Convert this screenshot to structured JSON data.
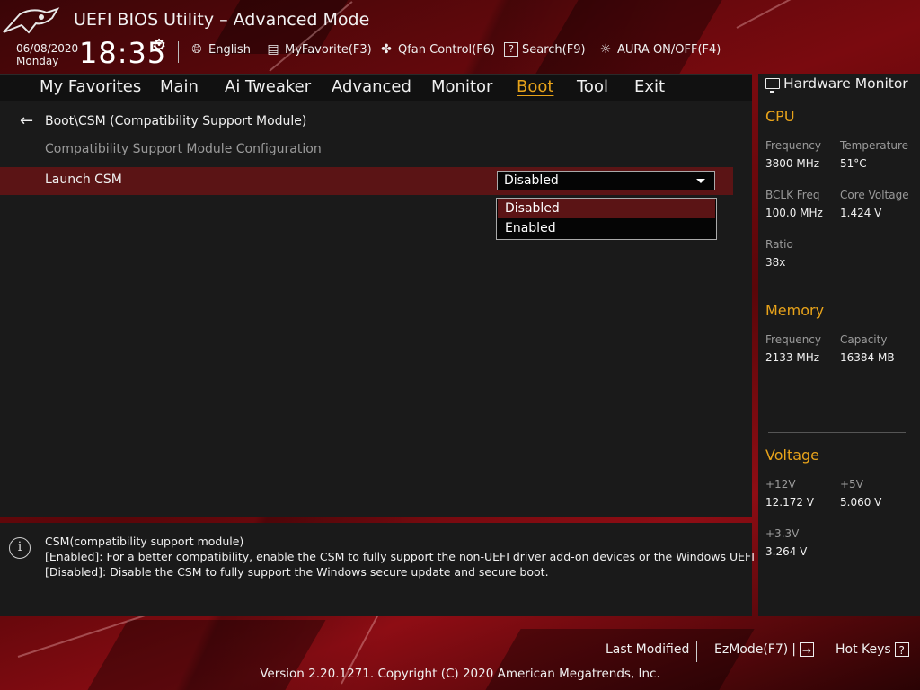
{
  "header": {
    "title": "UEFI BIOS Utility – Advanced Mode",
    "date": "06/08/2020",
    "day": "Monday",
    "time": "18:35",
    "tools": [
      {
        "label": "English",
        "icon": "globe-icon"
      },
      {
        "label": "MyFavorite(F3)",
        "icon": "favorite-list-icon"
      },
      {
        "label": "Qfan Control(F6)",
        "icon": "fan-icon"
      },
      {
        "label": "Search(F9)",
        "icon": "search-help-icon"
      },
      {
        "label": "AURA ON/OFF(F4)",
        "icon": "aura-light-icon"
      }
    ]
  },
  "menu": {
    "items": [
      "My Favorites",
      "Main",
      "Ai Tweaker",
      "Advanced",
      "Monitor",
      "Boot",
      "Tool",
      "Exit"
    ],
    "active": "Boot"
  },
  "main": {
    "breadcrumb": "Boot\\CSM (Compatibility Support Module)",
    "subtitle": "Compatibility Support Module Configuration",
    "setting": {
      "label": "Launch CSM",
      "value": "Disabled",
      "options": [
        "Disabled",
        "Enabled"
      ],
      "highlighted_option": "Disabled"
    }
  },
  "help": {
    "lines": [
      "CSM(compatibility support module)",
      "[Enabled]: For a better compatibility, enable the CSM to fully support the non-UEFI driver add-on devices or the Windows UEFI mode.",
      "[Disabled]: Disable the CSM to fully support the Windows secure update and secure boot."
    ]
  },
  "hardware_monitor": {
    "title": "Hardware Monitor",
    "cpu": {
      "title": "CPU",
      "frequency_label": "Frequency",
      "frequency": "3800 MHz",
      "temperature_label": "Temperature",
      "temperature": "51°C",
      "bclk_label": "BCLK Freq",
      "bclk": "100.0 MHz",
      "core_voltage_label": "Core Voltage",
      "core_voltage": "1.424 V",
      "ratio_label": "Ratio",
      "ratio": "38x"
    },
    "memory": {
      "title": "Memory",
      "frequency_label": "Frequency",
      "frequency": "2133 MHz",
      "capacity_label": "Capacity",
      "capacity": "16384 MB"
    },
    "voltage": {
      "title": "Voltage",
      "v12_label": "+12V",
      "v12": "12.172 V",
      "v5_label": "+5V",
      "v5": "5.060 V",
      "v33_label": "+3.3V",
      "v33": "3.264 V"
    }
  },
  "footer": {
    "last_modified": "Last Modified",
    "ezmode": "EzMode(F7)",
    "hotkeys": "Hot Keys",
    "version": "Version 2.20.1271. Copyright (C) 2020 American Megatrends, Inc."
  },
  "colors": {
    "accent": "#e8a31a",
    "highlight_row": "#5b1415",
    "panel": "#1a1a1a"
  }
}
